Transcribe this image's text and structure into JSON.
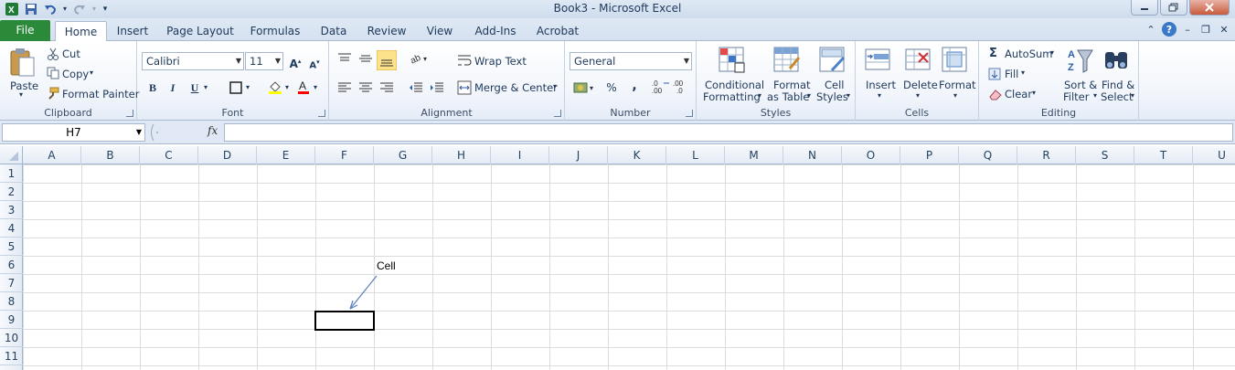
{
  "titlebar": {
    "title": "Book3  -  Microsoft Excel"
  },
  "tabs": {
    "file": "File",
    "items": [
      {
        "label": "Home",
        "active": true
      },
      {
        "label": "Insert"
      },
      {
        "label": "Page Layout"
      },
      {
        "label": "Formulas"
      },
      {
        "label": "Data"
      },
      {
        "label": "Review"
      },
      {
        "label": "View"
      },
      {
        "label": "Add-Ins"
      },
      {
        "label": "Acrobat"
      }
    ]
  },
  "ribbon": {
    "clipboard": {
      "label": "Clipboard",
      "paste": "Paste",
      "cut": "Cut",
      "copy": "Copy",
      "format_painter": "Format Painter"
    },
    "font": {
      "label": "Font",
      "name": "Calibri",
      "size": "11",
      "bold": "B",
      "italic": "I",
      "underline": "U"
    },
    "alignment": {
      "label": "Alignment",
      "wrap_text": "Wrap Text",
      "merge_center": "Merge & Center"
    },
    "number": {
      "label": "Number",
      "format": "General",
      "percent": "%",
      "comma": ","
    },
    "styles": {
      "label": "Styles",
      "conditional_1": "Conditional",
      "conditional_2": "Formatting",
      "format_table_1": "Format",
      "format_table_2": "as Table",
      "cell_styles_1": "Cell",
      "cell_styles_2": "Styles"
    },
    "cells": {
      "label": "Cells",
      "insert": "Insert",
      "delete": "Delete",
      "format": "Format"
    },
    "editing": {
      "label": "Editing",
      "autosum": "AutoSum",
      "fill": "Fill",
      "clear": "Clear",
      "sort_1": "Sort &",
      "sort_2": "Filter",
      "find_1": "Find &",
      "find_2": "Select"
    }
  },
  "formula_bar": {
    "name_box": "H7",
    "fx": "fx",
    "value": ""
  },
  "grid": {
    "columns": [
      "A",
      "B",
      "C",
      "D",
      "E",
      "F",
      "G",
      "H",
      "I",
      "J",
      "K",
      "L",
      "M",
      "N",
      "O",
      "P",
      "Q",
      "R",
      "S",
      "T",
      "U"
    ],
    "rows": [
      "1",
      "2",
      "3",
      "4",
      "5",
      "6",
      "7",
      "8",
      "9",
      "10",
      "11"
    ],
    "annotation": "Cell"
  },
  "colors": {
    "file_tab": "#2a8a3a",
    "ribbon_text": "#1e395b",
    "gridline": "#dadcdd",
    "arrow": "#5a7fc0"
  }
}
